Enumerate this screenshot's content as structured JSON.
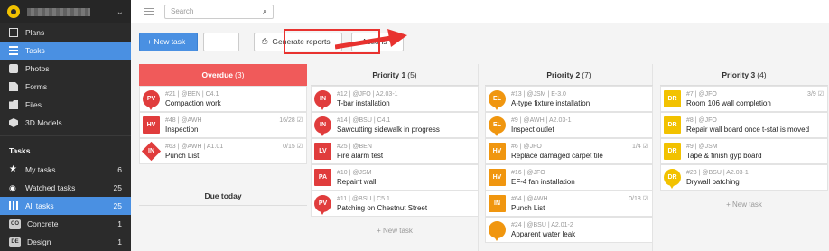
{
  "sidebar": {
    "nav": [
      {
        "label": "Plans",
        "icon": "plans-icon"
      },
      {
        "label": "Tasks",
        "icon": "tasks-icon"
      },
      {
        "label": "Photos",
        "icon": "camera-icon"
      },
      {
        "label": "Forms",
        "icon": "form-icon"
      },
      {
        "label": "Files",
        "icon": "folder-icon"
      },
      {
        "label": "3D Models",
        "icon": "cube-icon"
      }
    ],
    "section_title": "Tasks",
    "filters": [
      {
        "label": "My tasks",
        "count": "6",
        "icon": "star-icon"
      },
      {
        "label": "Watched tasks",
        "count": "25",
        "icon": "eye-icon"
      },
      {
        "label": "All tasks",
        "count": "25",
        "icon": "grid-icon"
      },
      {
        "label": "Concrete",
        "count": "1",
        "badge": "CO"
      },
      {
        "label": "Design",
        "count": "1",
        "badge": "DE"
      }
    ]
  },
  "topbar": {
    "search_placeholder": "Search"
  },
  "toolbar": {
    "new_task": "+ New task",
    "ghost": "",
    "generate_reports": "Generate reports",
    "actions": "Actions ▾"
  },
  "colors": {
    "accent": "#4a90e2",
    "overdue": "#f05a5a",
    "highlight": "#e8322f"
  },
  "columns": [
    {
      "title": "Overdue",
      "count": "(3)",
      "cards": [
        {
          "code": "PV",
          "shape": "pin",
          "color": "red",
          "meta": "#21 | @BEN | C4.1",
          "title": "Compaction work",
          "right": ""
        },
        {
          "code": "HV",
          "shape": "sq",
          "color": "red",
          "meta": "#48 | @AWH",
          "title": "Inspection",
          "right": "16/28 ☑"
        },
        {
          "code": "IN",
          "shape": "dia",
          "color": "red",
          "meta": "#63 | @AWH | A1.01",
          "title": "Punch List",
          "right": "0/15 ☑"
        }
      ],
      "subhead": "Due today"
    },
    {
      "title": "Priority 1",
      "count": "(5)",
      "cards": [
        {
          "code": "IN",
          "shape": "pin",
          "color": "red",
          "meta": "#12 | @JFO | A2.03-1",
          "title": "T-bar installation",
          "right": ""
        },
        {
          "code": "IN",
          "shape": "pin",
          "color": "red",
          "meta": "#14 | @BSU | C4.1",
          "title": "Sawcutting sidewalk in progress",
          "right": ""
        },
        {
          "code": "LV",
          "shape": "sq",
          "color": "red",
          "meta": "#25 | @BEN",
          "title": "Fire alarm test",
          "right": ""
        },
        {
          "code": "PA",
          "shape": "sq",
          "color": "red",
          "meta": "#10 | @JSM",
          "title": "Repaint wall",
          "right": ""
        },
        {
          "code": "PV",
          "shape": "pin",
          "color": "red",
          "meta": "#11 | @BSU | C5.1",
          "title": "Patching on Chestnut Street",
          "right": ""
        }
      ],
      "new_task": "+ New task"
    },
    {
      "title": "Priority 2",
      "count": "(7)",
      "cards": [
        {
          "code": "EL",
          "shape": "pin",
          "color": "orange",
          "meta": "#13 | @JSM | E-3.0",
          "title": "A-type fixture installation",
          "right": ""
        },
        {
          "code": "EL",
          "shape": "pin",
          "color": "orange",
          "meta": "#9 | @AWH | A2.03-1",
          "title": "Inspect outlet",
          "right": ""
        },
        {
          "code": "HV",
          "shape": "sq",
          "color": "orange",
          "meta": "#6 | @JFO",
          "title": "Replace damaged carpet tile",
          "right": "1/4 ☑"
        },
        {
          "code": "HV",
          "shape": "sq",
          "color": "orange",
          "meta": "#16 | @JFO",
          "title": "EF-4 fan installation",
          "right": ""
        },
        {
          "code": "IN",
          "shape": "sq",
          "color": "orange",
          "meta": "#64 | @AWH",
          "title": "Punch List",
          "right": "0/18 ☑"
        },
        {
          "code": "",
          "shape": "pin",
          "color": "orange",
          "meta": "#24 | @BSU | A2.01-2",
          "title": "Apparent water leak",
          "right": ""
        }
      ]
    },
    {
      "title": "Priority 3",
      "count": "(4)",
      "cards": [
        {
          "code": "DR",
          "shape": "sq",
          "color": "yellow",
          "meta": "#7 | @JFO",
          "title": "Room 106 wall completion",
          "right": "3/9 ☑"
        },
        {
          "code": "DR",
          "shape": "sq",
          "color": "yellow",
          "meta": "#8 | @JFO",
          "title": "Repair wall board once t-stat is moved",
          "right": ""
        },
        {
          "code": "DR",
          "shape": "sq",
          "color": "yellow",
          "meta": "#9 | @JSM",
          "title": "Tape & finish gyp board",
          "right": ""
        },
        {
          "code": "DR",
          "shape": "pin",
          "color": "yellow",
          "meta": "#23 | @BSU | A2.03-1",
          "title": "Drywall patching",
          "right": ""
        }
      ],
      "new_task": "+ New task"
    }
  ]
}
